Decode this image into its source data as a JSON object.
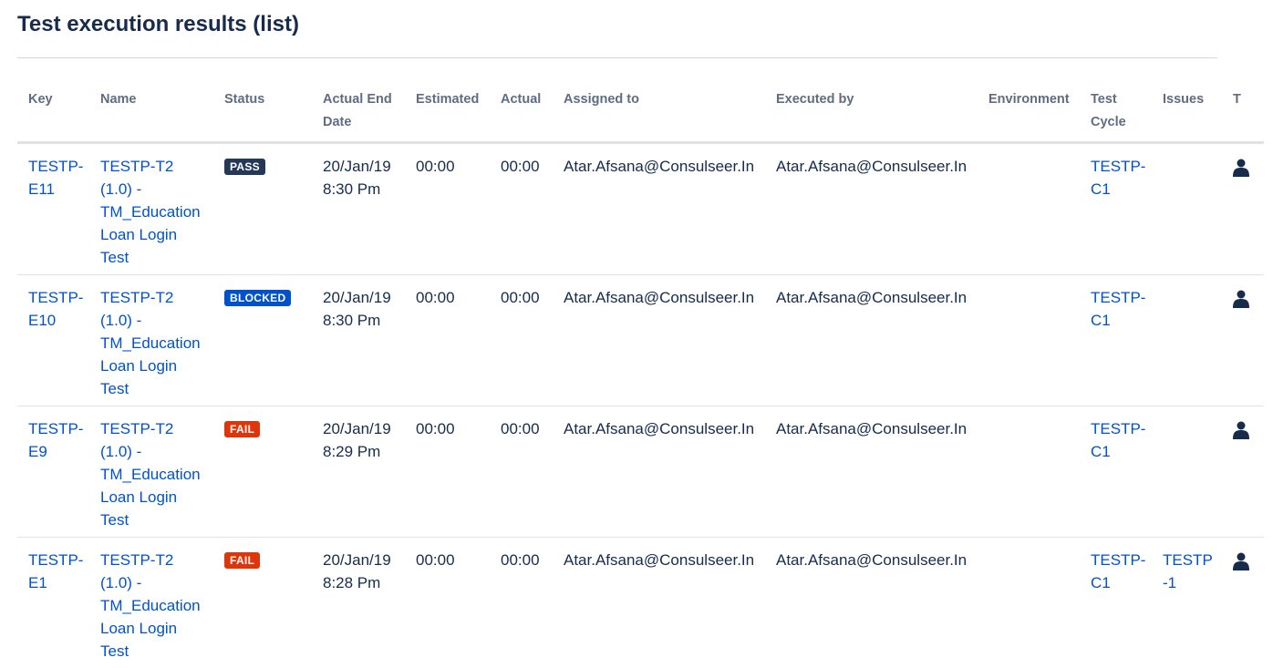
{
  "page": {
    "title": "Test execution results (list)"
  },
  "table": {
    "headers": {
      "key": "Key",
      "name": "Name",
      "status": "Status",
      "end_date": "Actual End Date",
      "estimated": "Estimated",
      "actual": "Actual",
      "assigned": "Assigned to",
      "executed": "Executed by",
      "environment": "Environment",
      "cycle": "Test Cycle",
      "issues": "Issues",
      "t": "T"
    },
    "rows": [
      {
        "key": "TESTP-E11",
        "name": "TESTP-T2 (1.0) - TM_Education Loan Login Test",
        "status": "PASS",
        "end_date": "20/Jan/19 8:30 Pm",
        "estimated": "00:00",
        "actual": "00:00",
        "assigned": "Atar.Afsana@Consulseer.In",
        "executed": "Atar.Afsana@Consulseer.In",
        "environment": "",
        "cycle": "TESTP-C1",
        "issues": ""
      },
      {
        "key": "TESTP-E10",
        "name": "TESTP-T2 (1.0) - TM_Education Loan Login Test",
        "status": "BLOCKED",
        "end_date": "20/Jan/19 8:30 Pm",
        "estimated": "00:00",
        "actual": "00:00",
        "assigned": "Atar.Afsana@Consulseer.In",
        "executed": "Atar.Afsana@Consulseer.In",
        "environment": "",
        "cycle": "TESTP-C1",
        "issues": ""
      },
      {
        "key": "TESTP-E9",
        "name": "TESTP-T2 (1.0) - TM_Education Loan Login Test",
        "status": "FAIL",
        "end_date": "20/Jan/19 8:29 Pm",
        "estimated": "00:00",
        "actual": "00:00",
        "assigned": "Atar.Afsana@Consulseer.In",
        "executed": "Atar.Afsana@Consulseer.In",
        "environment": "",
        "cycle": "TESTP-C1",
        "issues": ""
      },
      {
        "key": "TESTP-E1",
        "name": "TESTP-T2 (1.0) - TM_Education Loan Login Test",
        "status": "FAIL",
        "end_date": "20/Jan/19 8:28 Pm",
        "estimated": "00:00",
        "actual": "00:00",
        "assigned": "Atar.Afsana@Consulseer.In",
        "executed": "Atar.Afsana@Consulseer.In",
        "environment": "",
        "cycle": "TESTP-C1",
        "issues": "TESTP-1"
      }
    ]
  },
  "colors": {
    "link": "#0052cc",
    "pass": "#253858",
    "blocked": "#0052cc",
    "fail": "#de350b"
  },
  "icons": {
    "assignee": "user-icon"
  }
}
